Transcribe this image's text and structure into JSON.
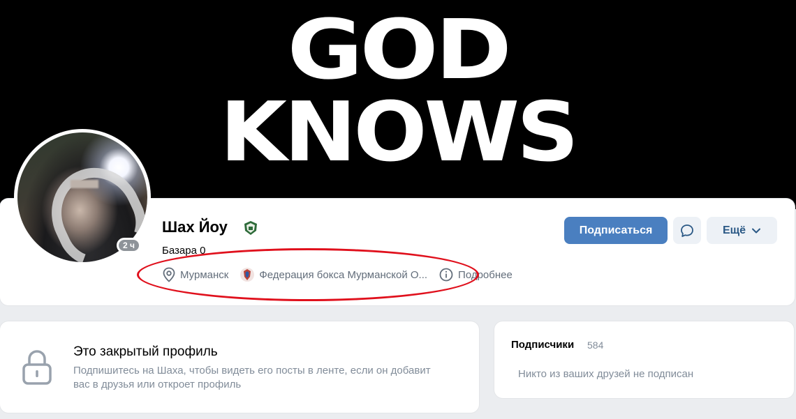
{
  "cover": {
    "line1": "GOD",
    "line2": "KNOWS"
  },
  "profile": {
    "name": "Шах Йоу",
    "status": "Базара 0",
    "online_badge": "2 ч",
    "city": "Мурманск",
    "organization": "Федерация бокса Мурманской О...",
    "more_info": "Подробнее"
  },
  "actions": {
    "subscribe": "Подписаться",
    "more": "Ещё"
  },
  "closed_profile": {
    "title": "Это закрытый профиль",
    "description": "Подпишитесь на Шаха, чтобы видеть его посты в ленте, если он добавит вас в друзья или откроет профиль"
  },
  "subscribers": {
    "title": "Подписчики",
    "count": "584",
    "empty_text": "Никто из ваших друзей не подписан"
  },
  "colors": {
    "accent": "#4a7fc0",
    "highlight": "#e0101c",
    "secondary_text": "#818c99"
  },
  "icons": [
    "location-pin-icon",
    "federation-emblem-icon",
    "info-icon",
    "message-icon",
    "chevron-down-icon",
    "lock-icon",
    "team-badge-icon"
  ]
}
